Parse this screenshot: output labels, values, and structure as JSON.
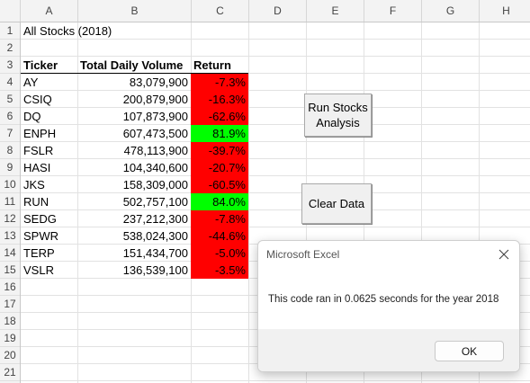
{
  "columns": [
    "A",
    "B",
    "C",
    "D",
    "E",
    "F",
    "G",
    "H"
  ],
  "rows": [
    "1",
    "2",
    "3",
    "4",
    "5",
    "6",
    "7",
    "8",
    "9",
    "10",
    "11",
    "12",
    "13",
    "14",
    "15",
    "16",
    "17",
    "18",
    "19",
    "20",
    "21"
  ],
  "sheet": {
    "title": "All Stocks (2018)",
    "headers": {
      "ticker": "Ticker",
      "volume": "Total Daily Volume",
      "return": "Return"
    },
    "data": [
      {
        "ticker": "AY",
        "volume": "83,079,900",
        "ret": "-7.3%",
        "color": "#ff0000"
      },
      {
        "ticker": "CSIQ",
        "volume": "200,879,900",
        "ret": "-16.3%",
        "color": "#ff0000"
      },
      {
        "ticker": "DQ",
        "volume": "107,873,900",
        "ret": "-62.6%",
        "color": "#ff0000"
      },
      {
        "ticker": "ENPH",
        "volume": "607,473,500",
        "ret": "81.9%",
        "color": "#00ff00"
      },
      {
        "ticker": "FSLR",
        "volume": "478,113,900",
        "ret": "-39.7%",
        "color": "#ff0000"
      },
      {
        "ticker": "HASI",
        "volume": "104,340,600",
        "ret": "-20.7%",
        "color": "#ff0000"
      },
      {
        "ticker": "JKS",
        "volume": "158,309,000",
        "ret": "-60.5%",
        "color": "#ff0000"
      },
      {
        "ticker": "RUN",
        "volume": "502,757,100",
        "ret": "84.0%",
        "color": "#00ff00"
      },
      {
        "ticker": "SEDG",
        "volume": "237,212,300",
        "ret": "-7.8%",
        "color": "#ff0000"
      },
      {
        "ticker": "SPWR",
        "volume": "538,024,300",
        "ret": "-44.6%",
        "color": "#ff0000"
      },
      {
        "ticker": "TERP",
        "volume": "151,434,700",
        "ret": "-5.0%",
        "color": "#ff0000"
      },
      {
        "ticker": "VSLR",
        "volume": "136,539,100",
        "ret": "-3.5%",
        "color": "#ff0000"
      }
    ]
  },
  "buttons": {
    "run_line1": "Run Stocks",
    "run_line2": "Analysis",
    "clear": "Clear Data"
  },
  "dialog": {
    "title": "Microsoft Excel",
    "message": "This code ran in 0.0625 seconds for the year 2018",
    "ok": "OK"
  }
}
